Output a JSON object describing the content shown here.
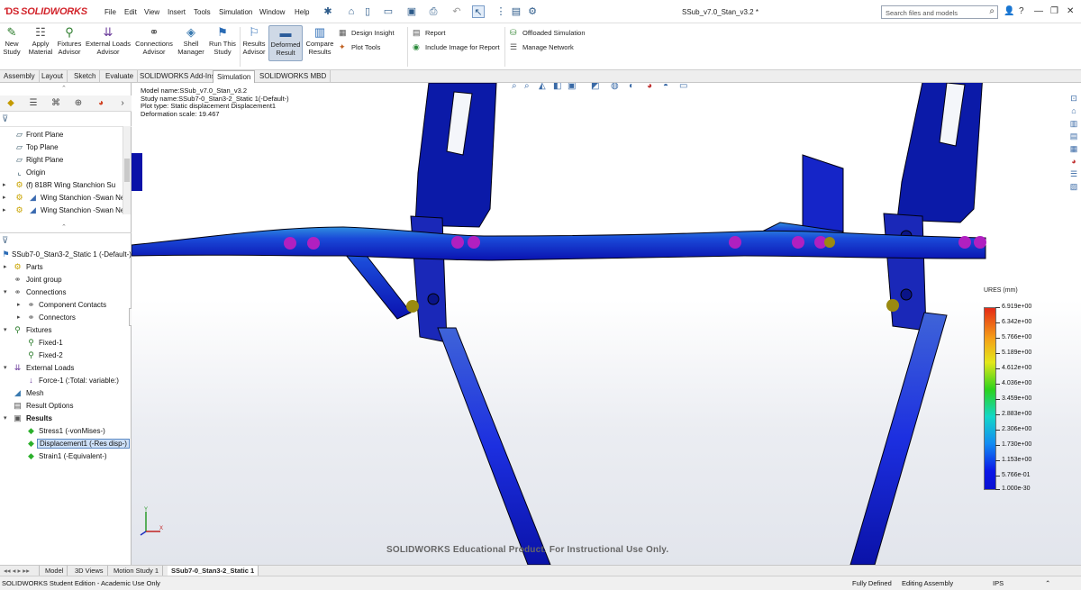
{
  "app": {
    "brand": "SOLIDWORKS",
    "document_title": "SSub_v7.0_Stan_v3.2 *"
  },
  "menu": [
    "File",
    "Edit",
    "View",
    "Insert",
    "Tools",
    "Simulation",
    "Window",
    "Help"
  ],
  "search": {
    "placeholder": "Search files and models"
  },
  "ribbon": {
    "new_study": "New Study",
    "apply_material": "Apply Material",
    "fixtures_advisor": "Fixtures Advisor",
    "external_loads_advisor": "External Loads Advisor",
    "connections_advisor": "Connections Advisor",
    "shell_manager": "Shell Manager",
    "run_this_study": "Run This Study",
    "results_advisor": "Results Advisor",
    "deformed_result": "Deformed Result",
    "compare_results": "Compare Results",
    "design_insight": "Design Insight",
    "plot_tools": "Plot Tools",
    "report": "Report",
    "include_image": "Include Image for Report",
    "offloaded_simulation": "Offloaded Simulation",
    "manage_network": "Manage Network"
  },
  "cmd_tabs": [
    "Assembly",
    "Layout",
    "Sketch",
    "Evaluate",
    "SOLIDWORKS Add-Ins",
    "Simulation",
    "SOLIDWORKS MBD"
  ],
  "feature_tree": [
    {
      "label": "Front Plane"
    },
    {
      "label": "Top Plane"
    },
    {
      "label": "Right Plane"
    },
    {
      "label": "Origin"
    },
    {
      "label": "(f) 818R Wing Stanchion Su"
    },
    {
      "label": "Wing Stanchion -Swan Ne"
    },
    {
      "label": "Wing Stanchion -Swan Ne"
    }
  ],
  "sim_tree": [
    {
      "label": "SSub7-0_Stan3-2_Static 1 (-Default-)"
    },
    {
      "label": "Parts"
    },
    {
      "label": "Joint group"
    },
    {
      "label": "Connections"
    },
    {
      "label": "Component Contacts"
    },
    {
      "label": "Connectors"
    },
    {
      "label": "Fixtures"
    },
    {
      "label": "Fixed-1"
    },
    {
      "label": "Fixed-2"
    },
    {
      "label": "External Loads"
    },
    {
      "label": "Force-1 (:Total: variable:)"
    },
    {
      "label": "Mesh"
    },
    {
      "label": "Result Options"
    },
    {
      "label": "Results"
    },
    {
      "label": "Stress1 (-vonMises-)"
    },
    {
      "label": "Displacement1 (-Res disp-)"
    },
    {
      "label": "Strain1 (-Equivalent-)"
    }
  ],
  "plot_info": [
    "Model name:SSub_v7.0_Stan_v3.2",
    "Study name:SSub7-0_Stan3-2_Static 1(-Default-)",
    "Plot type: Static displacement Displacement1",
    "Deformation scale: 19.467"
  ],
  "legend": {
    "title": "URES (mm)",
    "values": [
      "6.919e+00",
      "6.342e+00",
      "5.766e+00",
      "5.189e+00",
      "4.612e+00",
      "4.036e+00",
      "3.459e+00",
      "2.883e+00",
      "2.306e+00",
      "1.730e+00",
      "1.153e+00",
      "5.766e-01",
      "1.000e-30"
    ],
    "colors": [
      "#e42a16",
      "#f5a118",
      "#e3e71a",
      "#2cd21b",
      "#14d6c8",
      "#138bf2",
      "#0b17e7",
      "#0a10d1"
    ]
  },
  "watermark": "SOLIDWORKS Educational Product. For Instructional Use Only.",
  "bottom_tabs": [
    "Model",
    "3D Views",
    "Motion Study 1",
    "SSub7-0_Stan3-2_Static 1"
  ],
  "status": {
    "left": "SOLIDWORKS Student Edition - Academic Use Only",
    "defined": "Fully Defined",
    "mode": "Editing Assembly",
    "units": "IPS"
  }
}
